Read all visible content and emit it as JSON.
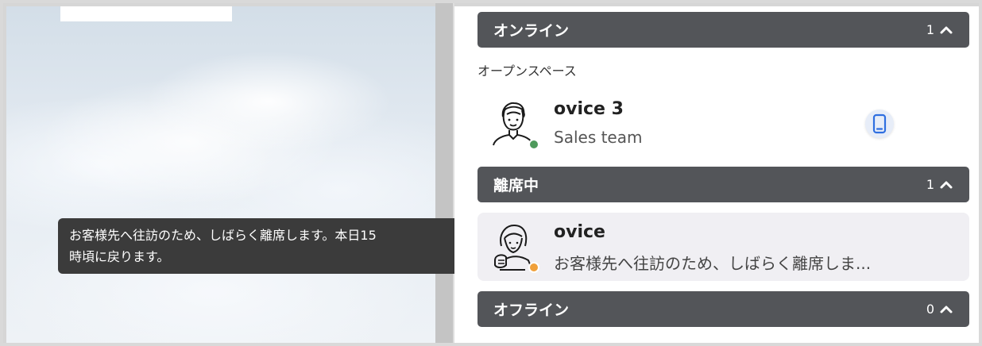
{
  "tooltip": {
    "line1": "お客様先へ往訪のため、しばらく離席します。本日15",
    "line2": "時頃に戻ります。"
  },
  "sections": {
    "online": {
      "title": "オンライン",
      "count": "1"
    },
    "away": {
      "title": "離席中",
      "count": "1"
    },
    "offline": {
      "title": "オフライン",
      "count": "0"
    }
  },
  "space_label": "オープンスペース",
  "users": {
    "online_user": {
      "name": "ovice 3",
      "sub": "Sales team",
      "status_color": "#4e9a5c",
      "device_icon": "smartphone-icon"
    },
    "away_user": {
      "name": "ovice",
      "sub": "お客様先へ往訪のため、しばらく離席しま...",
      "status_color": "#f0a03a"
    }
  },
  "colors": {
    "header_bg": "#535559",
    "away_row_bg": "#f0eff3",
    "device_accent": "#2f6fe0"
  }
}
